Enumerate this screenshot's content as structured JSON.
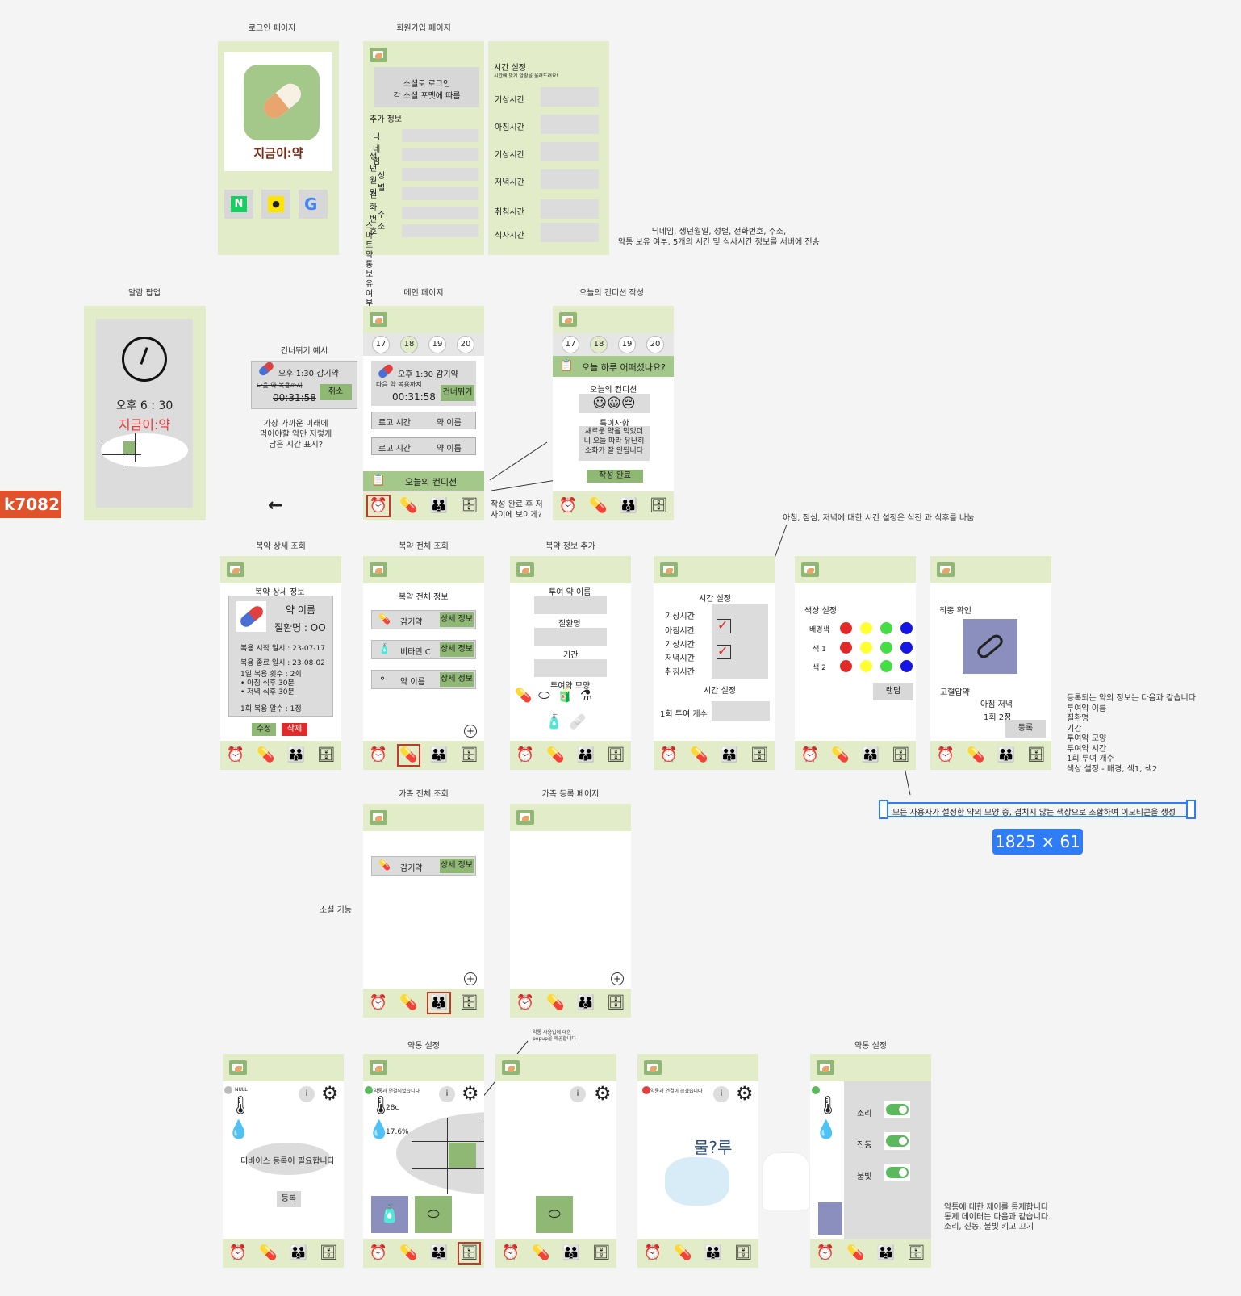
{
  "titles": {
    "login": "로그인 페이지",
    "signup": "회원가입 페이지",
    "alarm": "알람 팝업",
    "main": "메인 페이지",
    "condition": "오늘의 컨디션 작성",
    "skip": "건너뛰기 예시",
    "detail": "복약 상세 조회",
    "all": "복약 전체 조회",
    "add": "복약 정보 추가",
    "family_all": "가족 전체 조회",
    "family_reg": "가족 등록 페이지",
    "pillbox1": "약통 설정",
    "pillbox2": "약통 설정"
  },
  "login": {
    "logo_text": "지금이:약",
    "naver": "N"
  },
  "signup": {
    "social": "소셜로 로그인\n각 소셜 포맷에 따름",
    "extra": "추가 정보",
    "fields": [
      "닉네임",
      "생년월일",
      "성별",
      "전화번호",
      "주소",
      "스마트약통\n보유 여부"
    ]
  },
  "time": {
    "title": "시간 설정",
    "sub": "시간에 맞게 알람을 울려드려요!",
    "fields": [
      "기상시간",
      "아침시간",
      "기상시간",
      "저녁시간",
      "취침시간",
      "식사시간"
    ]
  },
  "notes": {
    "signup_note": "닉네임, 생년월일, 성별, 전화번호, 주소,\n약통 보유 여부, 5개의 시간 및 식사시간 정보를 서버에 전송",
    "skip_note": "가장 가까운 미래에\n먹어야할 약만 저렇게\n남은 시간 표시?",
    "cond_note": "작성 완료 후 저\n사이에 보이게?",
    "time_note": "아침, 점심, 저녁에 대한 시간 설정은 식전 과 식후를 나눔",
    "reg_note": "등록되는 약의 정보는 다음과 같습니다\n투여약 이름\n질환명\n기간\n투여약 모양\n투여약 시간\n1회 투여 개수\n색상 설정 - 배경, 색1, 색2",
    "social": "소셜 기능",
    "pill_note": "약통 사용법에 대한\npopup을 제공합니다",
    "box_note": "약통에 대한 제어를 통제합니다\n통제 데이터는 다음과 같습니다.\n소리, 진동, 불빛 키고 끄기",
    "selected": "모든 사용자가 설정한 약의 모양 중, 겹치지 않는 색상으로 조합하여 이모티콘을 생성",
    "size": "1825 × 61",
    "user": "k7082"
  },
  "alarm": {
    "time": "오후 6 : 30",
    "brand": "지금이:약"
  },
  "dates": [
    "17",
    "18",
    "19",
    "20"
  ],
  "main": {
    "med": "오후 1:30 감기약",
    "next": "다음 약 복용까지",
    "countdown": "00:31:58",
    "skip": "건너뛰기",
    "rows": [
      [
        "로고 시간",
        "약 이름"
      ],
      [
        "로고 시간",
        "약 이름"
      ]
    ],
    "cond": "오늘의 컨디션"
  },
  "skip": {
    "med": "오후 1:30 감기약",
    "next": "다음 약 복용까지",
    "countdown": "00:31:58",
    "cancel": "취소"
  },
  "condition": {
    "question": "오늘 하루 어떠셨나요?",
    "cond": "오늘의 컨디션",
    "special": "특이사항",
    "text": "새로운 약을 먹었더\n니 오늘 따라 유난히\n소화가 잘 안됩니다",
    "done": "작성 완료"
  },
  "detail": {
    "head": "복약 상세 정보",
    "name": "약 이름",
    "disease": "질환명 : OO",
    "start": "복용 시작 일시 : 23-07-17",
    "end": "복용 종료 일시 : 23-08-02",
    "count": "1일 복용 횟수 : 2회\n• 아침 식후 30분\n• 저녁 식후 30분",
    "per": "1회 복용 알수 : 1정",
    "edit": "수정",
    "del": "삭제"
  },
  "all": {
    "head": "복약 전체 정보",
    "items": [
      "감기약",
      "비타민 C",
      "약 이름"
    ],
    "btn": "상세 정보"
  },
  "add": {
    "name": "투여 약 이름",
    "disease": "질환명",
    "period": "기간",
    "shape": "투여약 모양"
  },
  "time2": {
    "title": "시간 설정",
    "fields": [
      "기상시간",
      "아침시간",
      "기상시간",
      "저녁시간",
      "취침시간"
    ],
    "sub": "시간 설정",
    "count": "1회 투여 개수"
  },
  "color": {
    "title": "색상 설정",
    "rows": [
      "배경색",
      "색 1",
      "색 2"
    ],
    "random": "랜덤"
  },
  "final": {
    "title": "최종 확인",
    "name": "고혈압약",
    "when": "아침 저녁",
    "dose": "1회 2정",
    "reg": "등록"
  },
  "family": {
    "item": "감기약",
    "btn": "상세 정보"
  },
  "pillbox": {
    "null": "NULL",
    "need": "디바이스 등록이 필요합니다",
    "reg": "등록",
    "connected": "약통과 연결되었습니다",
    "temp": "28c",
    "hum": "17.6%",
    "disconnected": "약통과 연결이 끊겼습니다",
    "sound": "소리",
    "vib": "진동",
    "light": "불빛",
    "meme": "물?루"
  }
}
